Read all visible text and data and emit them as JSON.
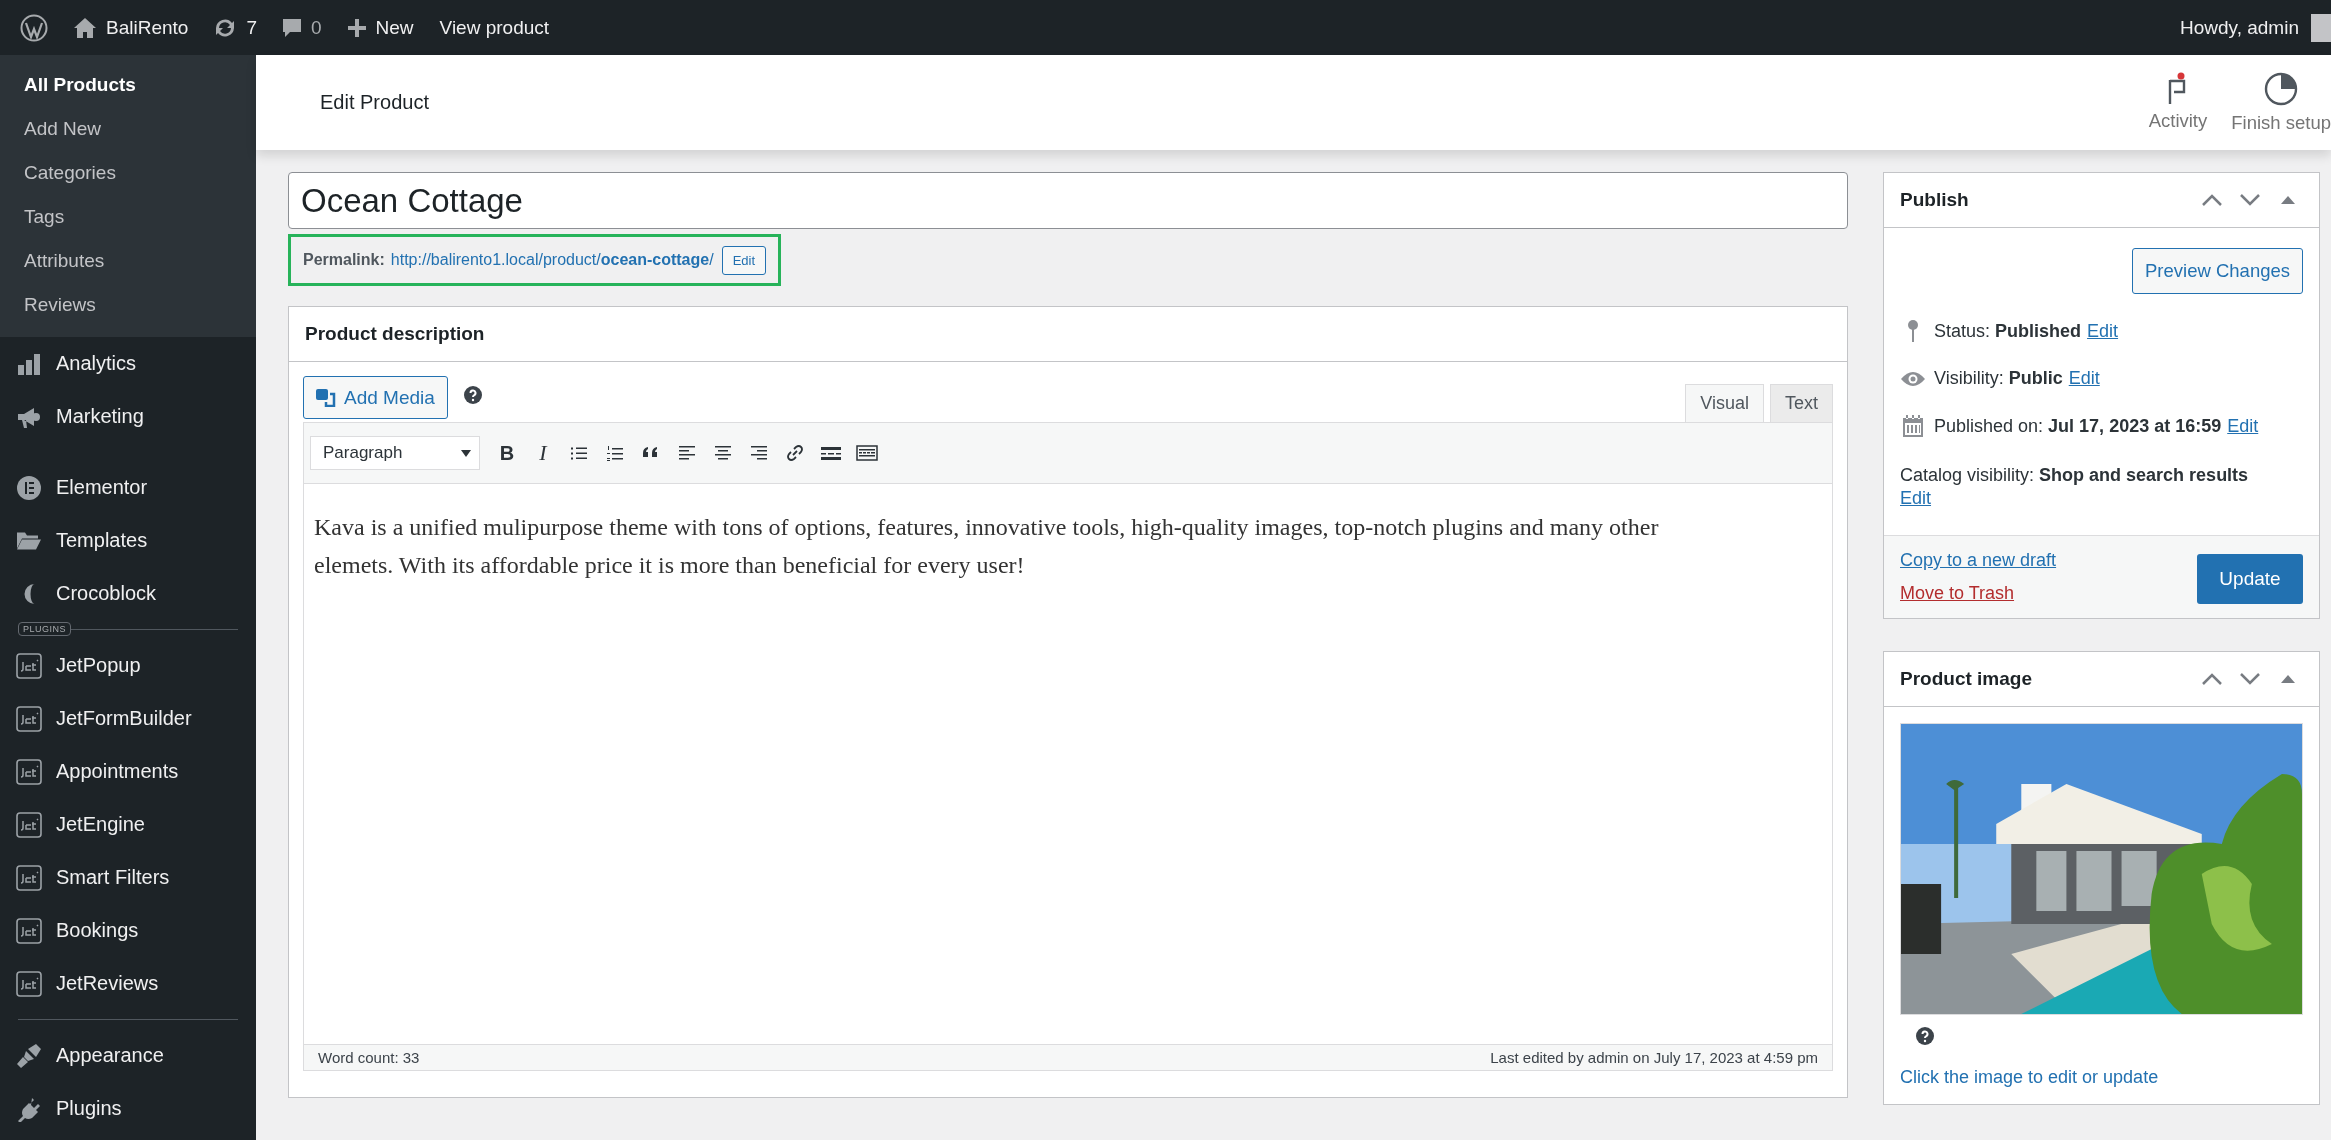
{
  "admin_bar": {
    "site": "BaliRento",
    "updates": "7",
    "comments": "0",
    "new": "New",
    "view": "View product",
    "account": "Howdy, admin"
  },
  "sidebar": {
    "submenu": [
      {
        "label": "All Products",
        "selected": true
      },
      {
        "label": "Add New",
        "selected": false
      },
      {
        "label": "Categories",
        "selected": false
      },
      {
        "label": "Tags",
        "selected": false
      },
      {
        "label": "Attributes",
        "selected": false
      },
      {
        "label": "Reviews",
        "selected": false
      }
    ],
    "groups": [
      {
        "divider": false,
        "items": [
          "Analytics",
          "Marketing"
        ]
      },
      {
        "divider": false,
        "items": [
          "Elementor",
          "Templates",
          "Crocoblock"
        ]
      },
      {
        "divider": true,
        "label": "PLUGINS",
        "items": [
          "JetPopup",
          "JetFormBuilder",
          "Appointments",
          "JetEngine",
          "Smart Filters",
          "Bookings",
          "JetReviews"
        ]
      },
      {
        "divider": true,
        "items": [
          "Appearance",
          "Plugins"
        ]
      }
    ]
  },
  "header": {
    "title": "Edit Product",
    "actions": [
      {
        "kind": "activity",
        "label": "Activity"
      },
      {
        "kind": "setup",
        "label": "Finish setup"
      }
    ]
  },
  "editor": {
    "title": "Ocean Cottage",
    "permalink": {
      "label": "Permalink:",
      "url": "http://balirento1.local/product/**ocean-cottage**/",
      "button": "Edit",
      "highlighted": true
    },
    "description": {
      "title": "Product description",
      "add_media": "Add Media",
      "tabs": [
        {
          "label": "Visual",
          "selected": true
        },
        {
          "label": "Text",
          "selected": false
        }
      ],
      "format": "Paragraph",
      "toolbar": [
        {
          "kind": "bold",
          "glyph": "B"
        },
        {
          "kind": "italic",
          "glyph": "I"
        },
        {
          "kind": "bullets"
        },
        {
          "kind": "numbers"
        },
        {
          "kind": "quote"
        },
        {
          "kind": "align-left"
        },
        {
          "kind": "align-center"
        },
        {
          "kind": "align-right"
        },
        {
          "kind": "link"
        },
        {
          "kind": "more"
        },
        {
          "kind": "kitchen"
        }
      ],
      "content": "Kava is a unified mulipurpose theme with tons of options, features, innovative tools, high-quality images, top-notch plugins and many other elemets. With its affordable price it is more than beneficial for every user!",
      "word_count": "Word count: 33",
      "last_edited": "Last edited by admin on July 17, 2023 at 4:59 pm"
    }
  },
  "publish": {
    "title": "Publish",
    "preview": "Preview Changes",
    "rows": [
      {
        "kind": "status",
        "text": "Status: **Published**",
        "action": "Edit"
      },
      {
        "kind": "visibility",
        "text": "Visibility: **Public**",
        "action": "Edit"
      },
      {
        "kind": "date",
        "text": "Published on: **Jul 17, 2023 at 16:59**",
        "action": "Edit"
      },
      {
        "kind": "catalog",
        "text": "Catalog visibility: **Shop and search results**",
        "action": "Edit"
      }
    ],
    "copy": "Copy to a new draft",
    "trash": "Move to Trash",
    "update": "Update"
  },
  "product_image": {
    "title": "Product image",
    "hint": "Click the image to edit or update"
  }
}
